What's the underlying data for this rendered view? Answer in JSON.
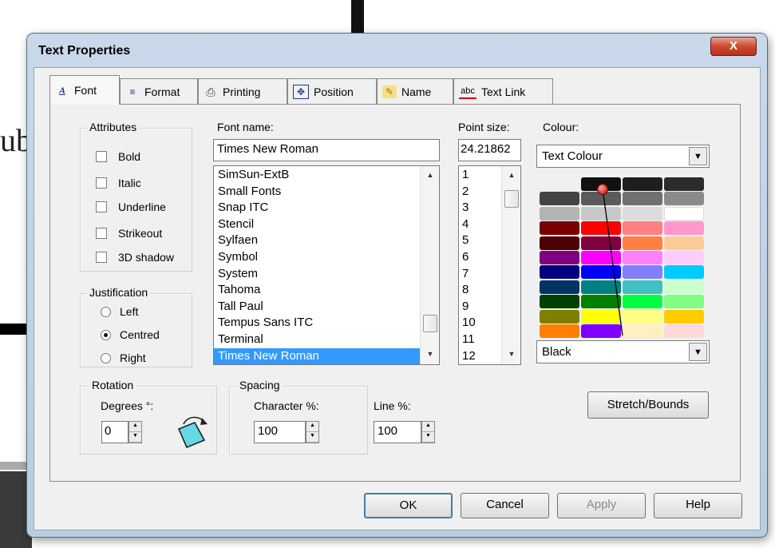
{
  "window": {
    "title": "Text Properties",
    "close_label": "X"
  },
  "background": {
    "partial_text": "ub"
  },
  "tabs": [
    {
      "label": "Font",
      "icon": "font-icon",
      "glyph": "A"
    },
    {
      "label": "Format",
      "icon": "format-list-icon",
      "glyph": "≡"
    },
    {
      "label": "Printing",
      "icon": "printer-icon",
      "glyph": "⎙"
    },
    {
      "label": "Position",
      "icon": "position-arrows-icon",
      "glyph": "✥"
    },
    {
      "label": "Name",
      "icon": "name-tag-icon",
      "glyph": "✎"
    },
    {
      "label": "Text Link",
      "icon": "text-link-icon",
      "glyph": "abc"
    }
  ],
  "attributes": {
    "legend": "Attributes",
    "options": [
      {
        "label": "Bold",
        "checked": false
      },
      {
        "label": "Italic",
        "checked": false
      },
      {
        "label": "Underline",
        "checked": false
      },
      {
        "label": "Strikeout",
        "checked": false
      },
      {
        "label": "3D shadow",
        "checked": false
      }
    ]
  },
  "justification": {
    "legend": "Justification",
    "options": [
      {
        "label": "Left",
        "selected": false
      },
      {
        "label": "Centred",
        "selected": true
      },
      {
        "label": "Right",
        "selected": false
      }
    ]
  },
  "font_name": {
    "label": "Font name:",
    "value": "Times New Roman",
    "items": [
      "SimSun-ExtB",
      "Small Fonts",
      "Snap ITC",
      "Stencil",
      "Sylfaen",
      "Symbol",
      "System",
      "Tahoma",
      "Tall Paul",
      "Tempus Sans ITC",
      "Terminal",
      "Times New Roman"
    ],
    "selected_index": 11
  },
  "point_size": {
    "label": "Point size:",
    "value": "24.21862",
    "items": [
      "1",
      "2",
      "3",
      "4",
      "5",
      "6",
      "7",
      "8",
      "9",
      "10",
      "11",
      "12"
    ]
  },
  "colour": {
    "label": "Colour:",
    "type_value": "Text Colour",
    "selected_value": "Black",
    "palette_rows": [
      [
        "",
        "#111111",
        "#1e1e1e",
        "#2c2c2c"
      ],
      [
        "#444444",
        "#5a5a5a",
        "#707070",
        "#8a8a8a"
      ],
      [
        "#b4b4b4",
        "#c8c8c8",
        "#dcdcdc",
        "#ffffff"
      ],
      [
        "#7a0000",
        "#ff0000",
        "#ff8080",
        "#ff99cc"
      ],
      [
        "#4d0000",
        "#800040",
        "#ff8040",
        "#ffcc99"
      ],
      [
        "#800080",
        "#ff00ff",
        "#ff80ff",
        "#ffccff"
      ],
      [
        "#000080",
        "#0000ff",
        "#8080ff",
        "#00ccff"
      ],
      [
        "#003366",
        "#008080",
        "#40c0c0",
        "#ccffcc"
      ],
      [
        "#004000",
        "#008000",
        "#00ff40",
        "#80ff80"
      ],
      [
        "#808000",
        "#ffff00",
        "#ffff80",
        "#ffcc00"
      ],
      [
        "#ff8000",
        "#8000ff",
        "#fff0c0",
        "#ffd8d8"
      ]
    ]
  },
  "rotation": {
    "legend": "Rotation",
    "label": "Degrees °:",
    "value": "0"
  },
  "spacing": {
    "legend": "Spacing",
    "character_label": "Character %:",
    "character_value": "100",
    "line_label": "Line %:",
    "line_value": "100"
  },
  "stretch_button": "Stretch/Bounds",
  "footer": {
    "ok": "OK",
    "cancel": "Cancel",
    "apply": "Apply",
    "help": "Help"
  }
}
